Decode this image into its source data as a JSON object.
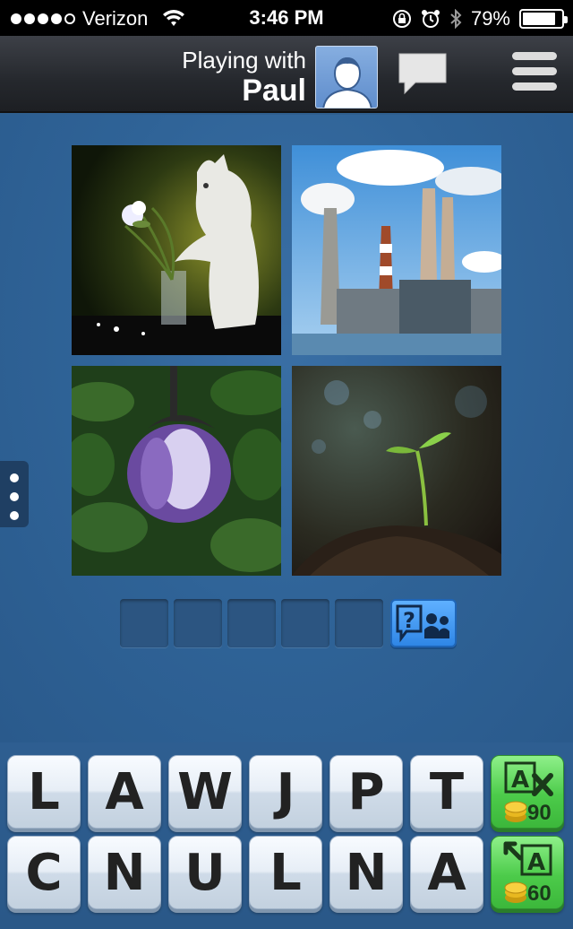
{
  "status_bar": {
    "carrier": "Verizon",
    "time": "3:46 PM",
    "battery": "79%",
    "signal_bars": 4,
    "signal_total": 5
  },
  "header": {
    "playing_with_label": "Playing with",
    "player_name": "Paul"
  },
  "puzzle": {
    "pictures": [
      "cat-with-flowers",
      "power-plant",
      "eggplant",
      "sprout"
    ],
    "answer_slots": 5
  },
  "keyboard": {
    "row1": [
      "L",
      "A",
      "W",
      "J",
      "P",
      "T"
    ],
    "row2": [
      "C",
      "N",
      "U",
      "L",
      "N",
      "A"
    ],
    "powerups": {
      "remove_letters_cost": "90",
      "reveal_letter_cost": "60"
    }
  },
  "colors": {
    "background": "#2f5f8f",
    "powerup_green": "#4ccb4a",
    "hint_blue": "#2f86e6"
  }
}
